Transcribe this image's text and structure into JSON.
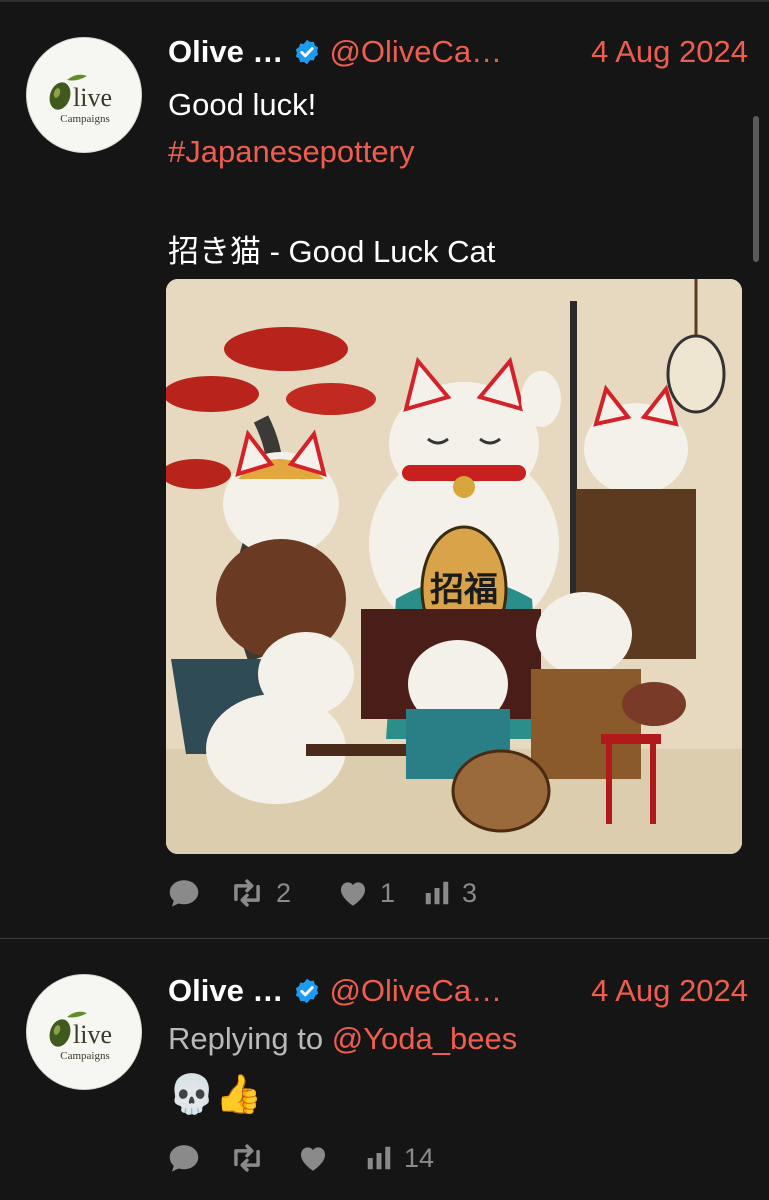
{
  "tweets": [
    {
      "author_name": "Olive …",
      "handle": "@OliveCa…",
      "date": "4 Aug 2024",
      "avatar": {
        "brand_line1": "live",
        "brand_letter": "O",
        "brand_line2": "Campaigns"
      },
      "lines": [
        "Good luck!",
        "#Japanesepottery",
        "招き猫 - Good Luck Cat"
      ],
      "image_alt": "Illustration of several maneki-neko lucky cats with bonsai trees, lantern, drum and pottery",
      "image_characters": "招福",
      "stats": {
        "reply": "",
        "retweet": "2",
        "like": "1",
        "views": "3"
      }
    },
    {
      "author_name": "Olive …",
      "handle": "@OliveCa…",
      "date": "4 Aug 2024",
      "avatar": {
        "brand_line1": "live",
        "brand_letter": "O",
        "brand_line2": "Campaigns"
      },
      "reply_prefix": "Replying to",
      "reply_to": "@Yoda_bees",
      "emojis": "💀👍",
      "stats": {
        "reply": "",
        "retweet": "",
        "like": "",
        "views": "14"
      }
    }
  ],
  "colors": {
    "background": "#151515",
    "accent": "#ef5d4f",
    "verified": "#1d9bf0",
    "muted": "#8a8a8a"
  },
  "icons": [
    "reply-icon",
    "retweet-icon",
    "like-icon",
    "views-icon",
    "verified-badge-icon"
  ]
}
